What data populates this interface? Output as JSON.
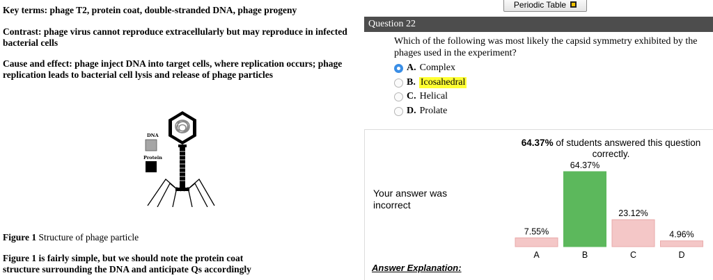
{
  "passage": {
    "key_terms": "Key terms: phage T2, protein coat, double-stranded DNA, phage progeny",
    "contrast_line1": "Contrast: phage virus cannot reproduce extracellularly but may reproduce in infected",
    "contrast_line2": "bacterial cells",
    "cause_line1": "Cause and effect: phage inject DNA into target cells, where replication occurs; phage",
    "cause_line2": "replication leads to bacterial cell lysis and release of phage particles",
    "figure_caption_label": "Figure 1",
    "figure_caption_text": " Structure of phage particle",
    "note_line1": "Figure 1 is fairly simple, but we should note the protein coat",
    "note_line2": "structure surrounding the DNA and anticipate Qs accordingly"
  },
  "figure": {
    "legend": [
      {
        "label": "DNA",
        "color": "#a6a6a6"
      },
      {
        "label": "Protein",
        "color": "#000000"
      }
    ]
  },
  "toolbar": {
    "periodic_table_label": "Periodic Table"
  },
  "question": {
    "header": "Question 22",
    "text_line1": "Which of the following was most likely the capsid symmetry exhibited by the",
    "text_line2": "phages used in the experiment?",
    "options": [
      {
        "letter": "A.",
        "text": "Complex",
        "selected": true,
        "highlighted": false
      },
      {
        "letter": "B.",
        "text": "Icosahedral",
        "selected": false,
        "highlighted": true
      },
      {
        "letter": "C.",
        "text": "Helical",
        "selected": false,
        "highlighted": false
      },
      {
        "letter": "D.",
        "text": "Prolate",
        "selected": false,
        "highlighted": false
      }
    ]
  },
  "results": {
    "stat_percent": "64.37%",
    "stat_text_line1": " of students answered this question",
    "stat_text_line2": "correctly.",
    "your_answer_line1": "Your answer was",
    "your_answer_line2": "incorrect",
    "explanation_label": "Answer Explanation:"
  },
  "colors": {
    "correct_bar": "#5cb85c",
    "incorrect_bar": "#f4c7c7",
    "incorrect_bar_border": "#e9aaaa",
    "highlight": "#ffff33",
    "header_bg": "#4d4d4d"
  },
  "chart_data": {
    "type": "bar",
    "categories": [
      "A",
      "B",
      "C",
      "D"
    ],
    "values": [
      7.55,
      64.37,
      23.12,
      4.96
    ],
    "labels": [
      "7.55%",
      "64.37%",
      "23.12%",
      "4.96%"
    ],
    "correct_category": "B",
    "ylim": [
      0,
      64.37
    ]
  }
}
